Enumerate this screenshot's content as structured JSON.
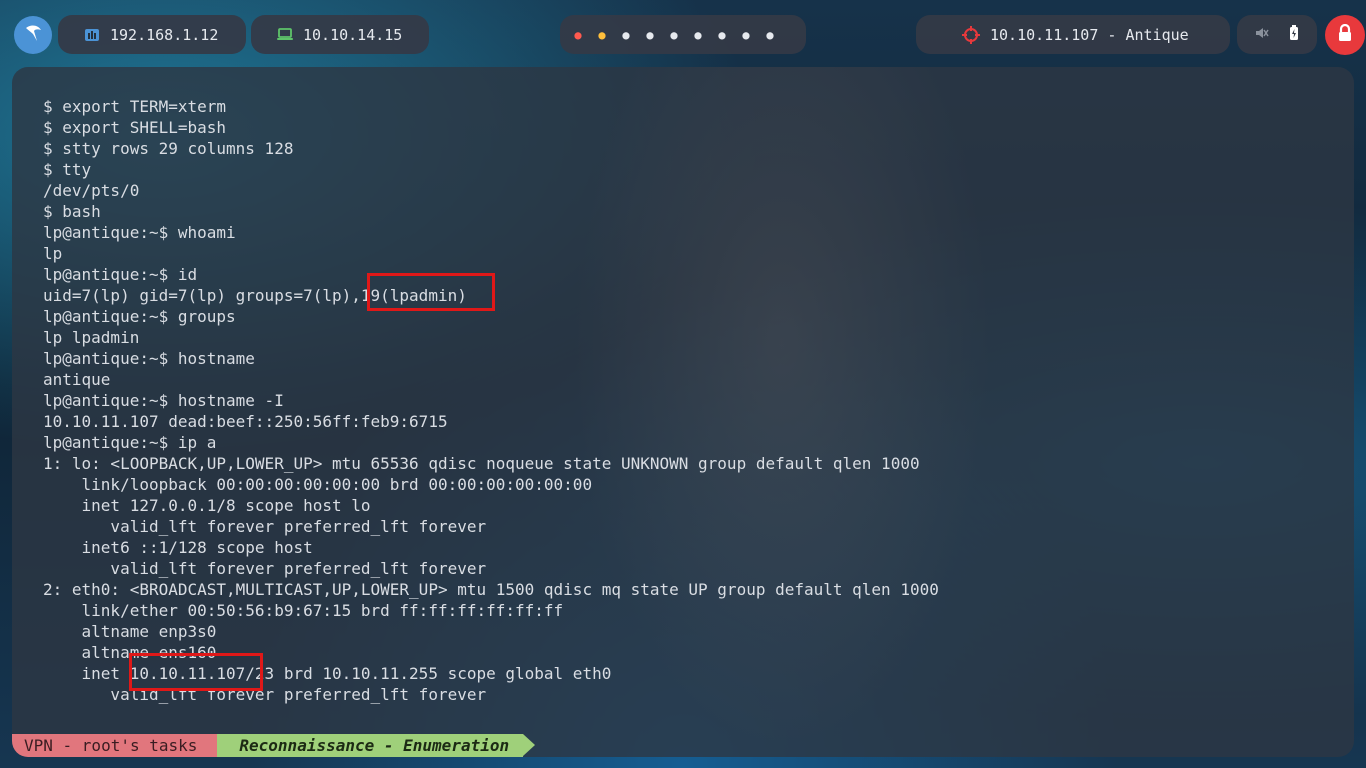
{
  "topbar": {
    "interface_ip": "192.168.1.12",
    "vpn_ip": "10.10.14.15",
    "target": "10.10.11.107 - Antique",
    "workspace_count": 9,
    "active_workspace_colors": [
      "#ff5a4f",
      "#ffbf3c"
    ]
  },
  "terminal": {
    "lines": [
      "$ export TERM=xterm",
      "$ export SHELL=bash",
      "$ stty rows 29 columns 128",
      "$ tty",
      "/dev/pts/0",
      "$ bash",
      "lp@antique:~$ whoami",
      "lp",
      "lp@antique:~$ id",
      "uid=7(lp) gid=7(lp) groups=7(lp),19(lpadmin)",
      "lp@antique:~$ groups",
      "lp lpadmin",
      "lp@antique:~$ hostname",
      "antique",
      "lp@antique:~$ hostname -I",
      "10.10.11.107 dead:beef::250:56ff:feb9:6715",
      "lp@antique:~$ ip a",
      "1: lo: <LOOPBACK,UP,LOWER_UP> mtu 65536 qdisc noqueue state UNKNOWN group default qlen 1000",
      "    link/loopback 00:00:00:00:00:00 brd 00:00:00:00:00:00",
      "    inet 127.0.0.1/8 scope host lo",
      "       valid_lft forever preferred_lft forever",
      "    inet6 ::1/128 scope host",
      "       valid_lft forever preferred_lft forever",
      "2: eth0: <BROADCAST,MULTICAST,UP,LOWER_UP> mtu 1500 qdisc mq state UP group default qlen 1000",
      "    link/ether 00:50:56:b9:67:15 brd ff:ff:ff:ff:ff:ff",
      "    altname enp3s0",
      "    altname ens160",
      "    inet 10.10.11.107/23 brd 10.10.11.255 scope global eth0",
      "       valid_lft forever preferred_lft forever"
    ]
  },
  "statusline": {
    "session": "VPN - root's tasks",
    "window": "Reconnaissance - Enumeration"
  },
  "colors": {
    "highlight": "#e01818",
    "status_session": "#e1767d",
    "status_window": "#9fd07a",
    "lock_button": "#e8393c",
    "menu_button": "#4b93d6"
  }
}
